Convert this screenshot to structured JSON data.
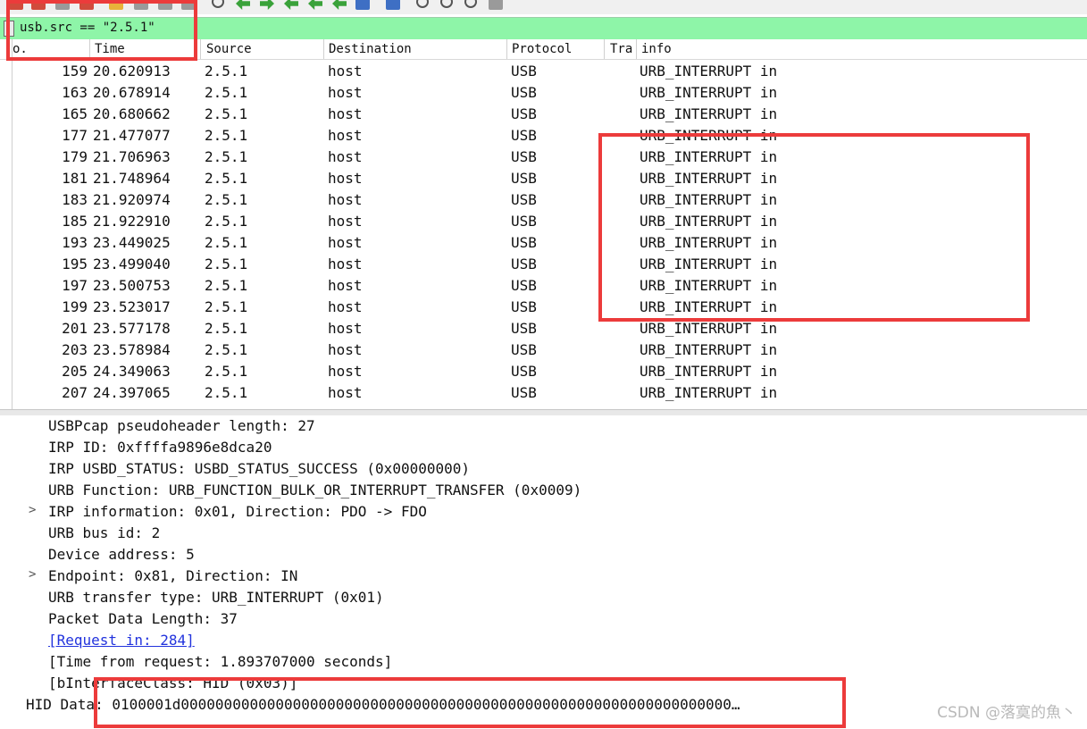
{
  "toolbar": {
    "icons": [
      "stop-icon",
      "restart-icon",
      "open-icon",
      "close-icon",
      "reload-icon",
      "find-icon",
      "back-icon",
      "forward-icon",
      "go-to-icon",
      "first-icon",
      "last-icon",
      "autoscroll-icon",
      "colorize-icon",
      "zoom-in-icon",
      "zoom-out-icon",
      "zoom-reset-icon",
      "resize-columns-icon"
    ]
  },
  "filter": {
    "value": "usb.src == \"2.5.1\""
  },
  "columns": [
    "o.",
    "Time",
    "Source",
    "Destination",
    "Protocol",
    "Tra:",
    "info"
  ],
  "packets": [
    {
      "no": "159",
      "time": "20.620913",
      "src": "2.5.1",
      "dst": "host",
      "proto": "USB",
      "info": "URB_INTERRUPT in"
    },
    {
      "no": "163",
      "time": "20.678914",
      "src": "2.5.1",
      "dst": "host",
      "proto": "USB",
      "info": "URB_INTERRUPT in"
    },
    {
      "no": "165",
      "time": "20.680662",
      "src": "2.5.1",
      "dst": "host",
      "proto": "USB",
      "info": "URB_INTERRUPT in"
    },
    {
      "no": "177",
      "time": "21.477077",
      "src": "2.5.1",
      "dst": "host",
      "proto": "USB",
      "info": "URB_INTERRUPT in"
    },
    {
      "no": "179",
      "time": "21.706963",
      "src": "2.5.1",
      "dst": "host",
      "proto": "USB",
      "info": "URB_INTERRUPT in"
    },
    {
      "no": "181",
      "time": "21.748964",
      "src": "2.5.1",
      "dst": "host",
      "proto": "USB",
      "info": "URB_INTERRUPT in"
    },
    {
      "no": "183",
      "time": "21.920974",
      "src": "2.5.1",
      "dst": "host",
      "proto": "USB",
      "info": "URB_INTERRUPT in"
    },
    {
      "no": "185",
      "time": "21.922910",
      "src": "2.5.1",
      "dst": "host",
      "proto": "USB",
      "info": "URB_INTERRUPT in"
    },
    {
      "no": "193",
      "time": "23.449025",
      "src": "2.5.1",
      "dst": "host",
      "proto": "USB",
      "info": "URB_INTERRUPT in"
    },
    {
      "no": "195",
      "time": "23.499040",
      "src": "2.5.1",
      "dst": "host",
      "proto": "USB",
      "info": "URB_INTERRUPT in"
    },
    {
      "no": "197",
      "time": "23.500753",
      "src": "2.5.1",
      "dst": "host",
      "proto": "USB",
      "info": "URB_INTERRUPT in"
    },
    {
      "no": "199",
      "time": "23.523017",
      "src": "2.5.1",
      "dst": "host",
      "proto": "USB",
      "info": "URB_INTERRUPT in"
    },
    {
      "no": "201",
      "time": "23.577178",
      "src": "2.5.1",
      "dst": "host",
      "proto": "USB",
      "info": "URB_INTERRUPT in"
    },
    {
      "no": "203",
      "time": "23.578984",
      "src": "2.5.1",
      "dst": "host",
      "proto": "USB",
      "info": "URB_INTERRUPT in"
    },
    {
      "no": "205",
      "time": "24.349063",
      "src": "2.5.1",
      "dst": "host",
      "proto": "USB",
      "info": "URB_INTERRUPT in"
    },
    {
      "no": "207",
      "time": "24.397065",
      "src": "2.5.1",
      "dst": "host",
      "proto": "USB",
      "info": "URB_INTERRUPT in"
    }
  ],
  "details": {
    "pseudoheader": "USBPcap pseudoheader length: 27",
    "irp_id": "IRP ID: 0xffffa9896e8dca20",
    "irp_status": "IRP USBD_STATUS: USBD_STATUS_SUCCESS (0x00000000)",
    "urb_function": "URB Function: URB_FUNCTION_BULK_OR_INTERRUPT_TRANSFER (0x0009)",
    "irp_info": "IRP information: 0x01, Direction: PDO -> FDO",
    "bus_id": "URB bus id: 2",
    "device_address": "Device address: 5",
    "endpoint": "Endpoint: 0x81, Direction: IN",
    "transfer_type": "URB transfer type: URB_INTERRUPT (0x01)",
    "data_length": "Packet Data Length: 37",
    "request_in": "[Request in: 284]",
    "time_from_request": "[Time from request: 1.893707000 seconds]",
    "interface_class": "[bInterfaceClass: HID (0x03)]",
    "hid_data": "HID Data: 0100001d0000000000000000000000000000000000000000000000000000000000000000…"
  },
  "watermark": "CSDN @落寞的魚丶",
  "colors": {
    "filter_bg": "#8ef5a8",
    "annotation_red": "#ec3b3b",
    "link": "#2233dd"
  }
}
